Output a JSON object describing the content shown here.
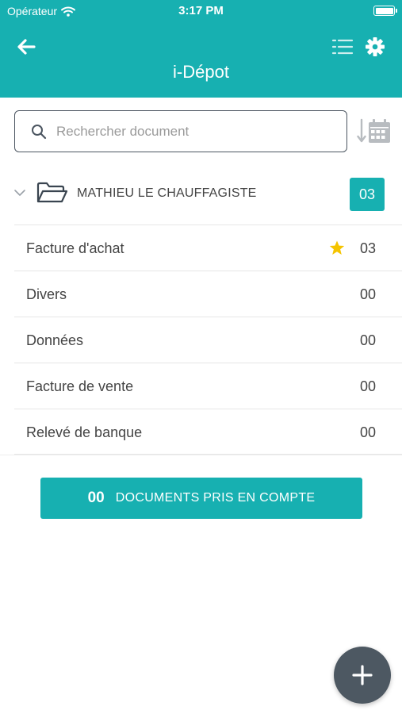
{
  "status_bar": {
    "carrier": "Opérateur",
    "time": "3:17 PM"
  },
  "header": {
    "title": "i-Dépot",
    "icons": [
      "back-arrow-icon",
      "list-icon",
      "gear-icon"
    ]
  },
  "search": {
    "placeholder": "Rechercher document",
    "value": ""
  },
  "folder": {
    "name": "MATHIEU LE CHAUFFAGISTE",
    "count": "03"
  },
  "categories": [
    {
      "label": "Facture d'achat",
      "count": "03",
      "starred": true
    },
    {
      "label": "Divers",
      "count": "00",
      "starred": false
    },
    {
      "label": "Données",
      "count": "00",
      "starred": false
    },
    {
      "label": "Facture de vente",
      "count": "00",
      "starred": false
    },
    {
      "label": "Relevé de banque",
      "count": "00",
      "starred": false
    }
  ],
  "documents_button": {
    "count": "00",
    "label": "DOCUMENTS PRIS EN COMPTE"
  },
  "colors": {
    "accent": "#17b0b1",
    "fab": "#4d5862",
    "star": "#f5c400"
  }
}
